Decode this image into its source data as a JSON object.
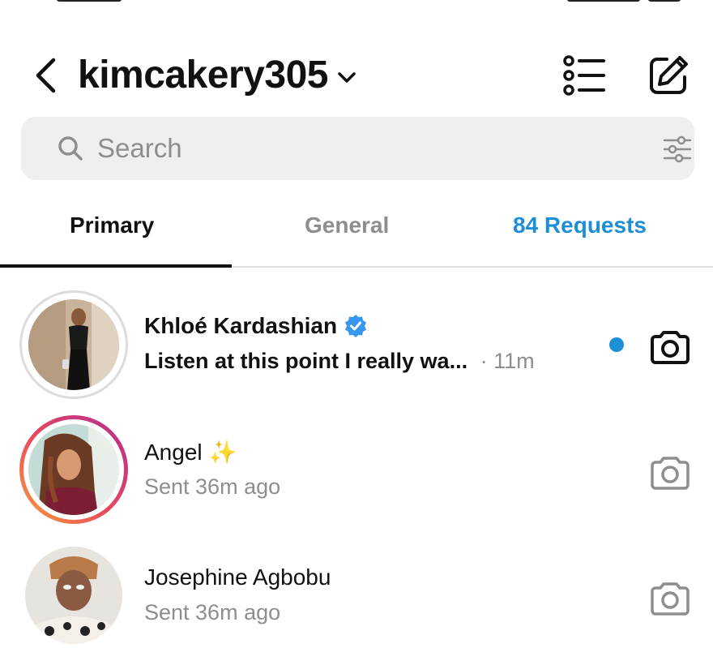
{
  "header": {
    "account_name": "kimcakery305"
  },
  "search": {
    "placeholder": "Search"
  },
  "tabs": [
    {
      "label": "Primary",
      "active": true
    },
    {
      "label": "General",
      "active": false
    },
    {
      "label": "84 Requests",
      "active": false
    }
  ],
  "threads": [
    {
      "name": "Khloé Kardashian",
      "verified": true,
      "preview": "Listen at this point I really wa...",
      "time": "· 11m",
      "unread": true,
      "avatar_ring": "seen"
    },
    {
      "name": "Angel",
      "emoji": "✨",
      "preview": "Sent 36m ago",
      "unread": false,
      "avatar_ring": "story"
    },
    {
      "name": "Josephine Agbobu",
      "preview": "Sent 36m ago",
      "unread": false,
      "avatar_ring": "none"
    }
  ],
  "colors": {
    "accent": "#1d8fd6",
    "verified": "#3897f0",
    "muted_text": "#8e8e8e",
    "search_bg": "#efefef"
  },
  "icons": {
    "back": "chevron-left-icon",
    "account_switch": "chevron-down-icon",
    "list": "list-icon",
    "compose": "compose-icon",
    "search": "search-icon",
    "filter": "sliders-icon",
    "verified": "verified-badge-icon",
    "camera": "camera-icon"
  }
}
